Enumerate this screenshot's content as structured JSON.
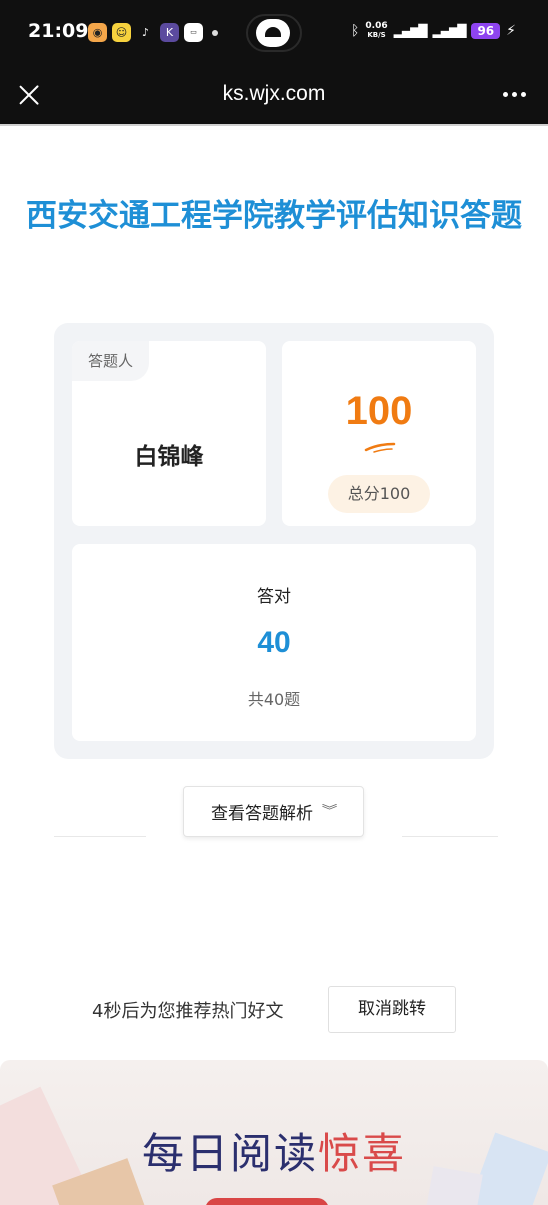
{
  "status_bar": {
    "time": "21:09",
    "net_speed_value": "0.06",
    "net_speed_unit": "KB/S",
    "battery": "96"
  },
  "browser": {
    "url": "ks.wjx.com"
  },
  "page": {
    "title": "西安交通工程学院教学评估知识答题",
    "respondent_tag": "答题人",
    "respondent_name": "白锦峰",
    "score": "100",
    "total_score": "总分100",
    "correct_label": "答对",
    "correct_count": "40",
    "total_questions": "共40题",
    "analysis_button": "查看答题解析",
    "redirect_text": "4秒后为您推荐热门好文",
    "cancel_button": "取消跳转"
  },
  "banner": {
    "title_part1": "每日阅读",
    "title_part2": "惊喜"
  },
  "colors": {
    "accent_blue": "#1e8fd6",
    "score_orange": "#f07b12",
    "banner_navy": "#2b2f6e",
    "banner_red": "#d94a4a"
  },
  "icons": [
    "close-icon",
    "more-icon",
    "chevron-down-icon",
    "bluetooth-icon",
    "signal-icon",
    "battery-icon",
    "charging-icon"
  ]
}
